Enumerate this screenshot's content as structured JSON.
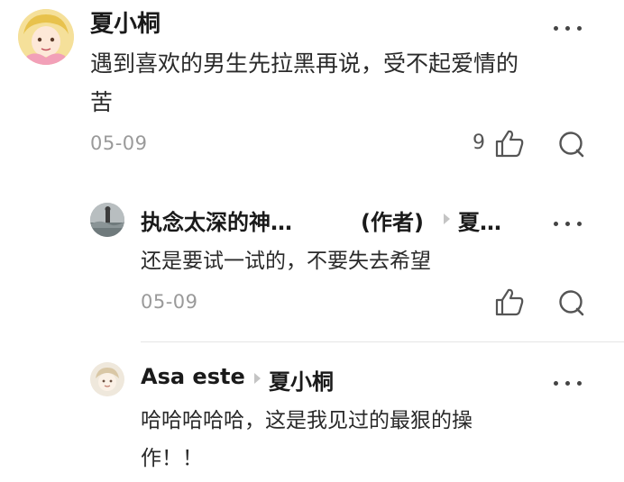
{
  "comments": [
    {
      "username": "夏小桐",
      "text_line1": "遇到喜欢的男生先拉黑再说，受不起爱情的",
      "text_line2": "苦",
      "date": "05-09",
      "like_count": "9"
    },
    {
      "username": "执念太深的神…",
      "author_tag": "(作者)",
      "reply_to": "夏…",
      "text_line1": "还是要试一试的，不要失去希望",
      "date": "05-09"
    },
    {
      "username": "Asa este",
      "reply_to": "夏小桐",
      "text_line1": "哈哈哈哈哈，这是我见过的最狠的操",
      "text_line2": "作！！"
    }
  ],
  "icons": {
    "more": "more-dots-icon",
    "like": "thumbs-up-icon",
    "reply": "chat-bubble-icon",
    "reply_arrow": "reply-arrow-icon"
  },
  "colors": {
    "text": "#1a1a1a",
    "secondary": "#9a9a9a",
    "divider": "#e6e6e6"
  }
}
